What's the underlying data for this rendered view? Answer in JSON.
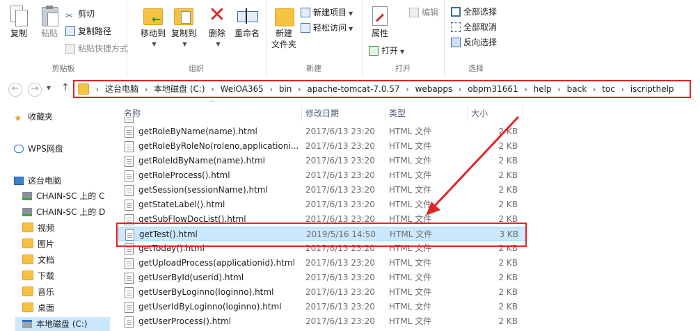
{
  "ribbon": {
    "clipboard": {
      "copy": "复制",
      "paste": "粘贴",
      "cut": "剪切",
      "copy_path": "复制路径",
      "paste_shortcut": "粘贴快捷方式",
      "label": "剪贴板"
    },
    "organize": {
      "move_to": "移动到",
      "copy_to": "复制到",
      "delete": "删除",
      "rename": "重命名",
      "label": "组织"
    },
    "new": {
      "new_folder": "新建\n文件夹",
      "new_item": "新建项目",
      "easy_access": "轻松访问",
      "label": "新建"
    },
    "open": {
      "properties": "属性",
      "open": "打开",
      "edit": "编辑",
      "label": "打开"
    },
    "select": {
      "select_all": "全部选择",
      "select_none": "全部取消",
      "invert": "反向选择",
      "label": "选择"
    }
  },
  "address": {
    "crumbs": [
      "这台电脑",
      "本地磁盘 (C:)",
      "WeiOA365",
      "bin",
      "apache-tomcat-7.0.57",
      "webapps",
      "obpm31661",
      "help",
      "back",
      "toc",
      "iscripthelp"
    ]
  },
  "navpane": {
    "items": [
      "收藏夹",
      "WPS网盘",
      "这台电脑",
      "CHAIN-SC 上的 C",
      "CHAIN-SC 上的 D",
      "视频",
      "图片",
      "文档",
      "下载",
      "音乐",
      "桌面",
      "本地磁盘 (C:)"
    ]
  },
  "columns": {
    "name": "名称",
    "date": "修改日期",
    "type": "类型",
    "size": "大小"
  },
  "files": [
    {
      "name": "getRoleByName(name).html",
      "date": "2017/6/13 23:20",
      "type": "HTML 文件",
      "size": "2 KB"
    },
    {
      "name": "getRoleByRoleNo(roleno,applicationi...",
      "date": "2017/6/13 23:20",
      "type": "HTML 文件",
      "size": "2 KB"
    },
    {
      "name": "getRoleIdByName(name).html",
      "date": "2017/6/13 23:20",
      "type": "HTML 文件",
      "size": "2 KB"
    },
    {
      "name": "getRoleProcess().html",
      "date": "2017/6/13 23:20",
      "type": "HTML 文件",
      "size": "2 KB"
    },
    {
      "name": "getSession(sessionName).html",
      "date": "2017/6/13 23:20",
      "type": "HTML 文件",
      "size": "2 KB"
    },
    {
      "name": "getStateLabel().html",
      "date": "2017/6/13 23:20",
      "type": "HTML 文件",
      "size": "2 KB"
    },
    {
      "name": "getSubFlowDocList().html",
      "date": "2017/6/13 23:20",
      "type": "HTML 文件",
      "size": "2 KB"
    },
    {
      "name": "getTest().html",
      "date": "2019/5/16 14:50",
      "type": "HTML 文件",
      "size": "3 KB"
    },
    {
      "name": "getToday().html",
      "date": "2017/6/13 23:20",
      "type": "HTML 文件",
      "size": "2 KB"
    },
    {
      "name": "getUploadProcess(applicationid).html",
      "date": "2017/6/13 23:20",
      "type": "HTML 文件",
      "size": "2 KB"
    },
    {
      "name": "getUserById(userid).html",
      "date": "2017/6/13 23:20",
      "type": "HTML 文件",
      "size": "2 KB"
    },
    {
      "name": "getUserByLoginno(loginno).html",
      "date": "2017/6/13 23:20",
      "type": "HTML 文件",
      "size": "2 KB"
    },
    {
      "name": "getUserIdByLoginno(loginno).html",
      "date": "2017/6/13 23:20",
      "type": "HTML 文件",
      "size": "2 KB"
    },
    {
      "name": "getUserProcess().html",
      "date": "2017/6/13 23:20",
      "type": "HTML 文件",
      "size": "2 KB"
    }
  ],
  "colors": {
    "annotation": "#e02424",
    "selection": "#cce8ff"
  }
}
